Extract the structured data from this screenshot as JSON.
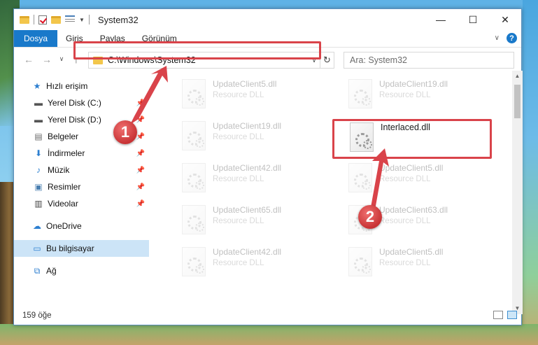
{
  "window": {
    "title": "System32",
    "controls": {
      "minimize": "—",
      "maximize": "☐",
      "close": "✕"
    }
  },
  "ribbon": {
    "tabs": [
      "Dosya",
      "Giriş",
      "Paylaş",
      "Görünüm"
    ],
    "help": "?"
  },
  "address_bar": {
    "path": "C:\\Windows\\System32",
    "search_placeholder": "Ara: System32"
  },
  "nav": {
    "quick_access": "Hızlı erişim",
    "items": [
      {
        "label": "Yerel Disk (C:)",
        "icon": "drive-icon",
        "pinned": true
      },
      {
        "label": "Yerel Disk (D:)",
        "icon": "drive-icon",
        "pinned": true
      },
      {
        "label": "Belgeler",
        "icon": "documents-icon",
        "pinned": true
      },
      {
        "label": "İndirmeler",
        "icon": "download-icon",
        "pinned": true
      },
      {
        "label": "Müzik",
        "icon": "music-icon",
        "pinned": true
      },
      {
        "label": "Resimler",
        "icon": "pictures-icon",
        "pinned": true
      },
      {
        "label": "Videolar",
        "icon": "video-icon",
        "pinned": true
      }
    ],
    "onedrive": "OneDrive",
    "this_pc": "Bu bilgisayar",
    "network": "Ağ"
  },
  "files": [
    {
      "name": "UpdateClient5.dll",
      "type": "Resource DLL"
    },
    {
      "name": "UpdateClient19.dll",
      "type": "Resource DLL"
    },
    {
      "name": "UpdateClient19.dll",
      "type": "Resource DLL"
    },
    {
      "name": "Interlaced.dll",
      "type": "",
      "highlighted": true
    },
    {
      "name": "UpdateClient42.dll",
      "type": "Resource DLL"
    },
    {
      "name": "UpdateClient5.dll",
      "type": "Resource DLL"
    },
    {
      "name": "UpdateClient65.dll",
      "type": "Resource DLL"
    },
    {
      "name": "UpdateClient63.dll",
      "type": "Resource DLL"
    },
    {
      "name": "UpdateClient42.dll",
      "type": "Resource DLL"
    },
    {
      "name": "UpdateClient5.dll",
      "type": "Resource DLL"
    }
  ],
  "status": {
    "item_count": "159 öğe"
  },
  "callouts": {
    "step1": "1",
    "step2": "2"
  },
  "colors": {
    "accent": "#1979ca",
    "highlight": "#d9434a",
    "selection": "#cce4f7"
  }
}
